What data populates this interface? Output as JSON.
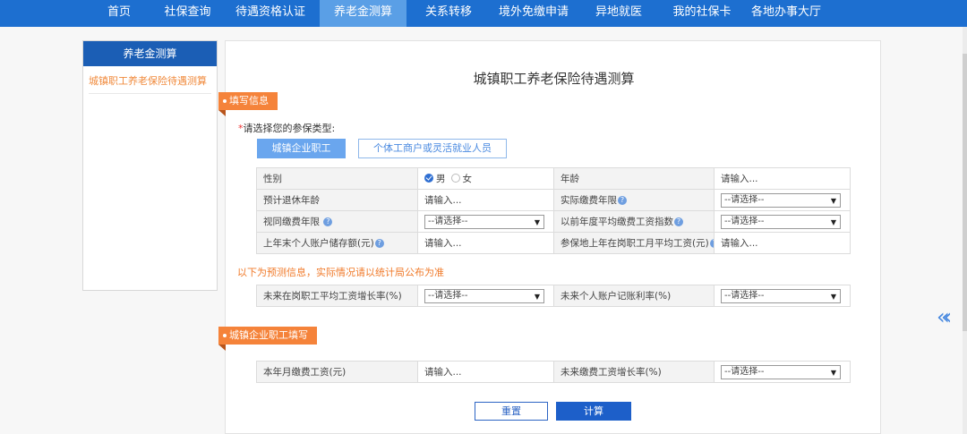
{
  "nav": {
    "items": [
      {
        "label": "首页",
        "active": false
      },
      {
        "label": "社保查询",
        "active": false
      },
      {
        "label": "待遇资格认证",
        "active": false
      },
      {
        "label": "养老金测算",
        "active": true
      },
      {
        "label": "关系转移",
        "active": false
      },
      {
        "label": "境外免缴申请",
        "active": false
      },
      {
        "label": "异地就医",
        "active": false
      },
      {
        "label": "我的社保卡",
        "active": false
      },
      {
        "label": "各地办事大厅",
        "active": false
      }
    ]
  },
  "sidebar": {
    "title": "养老金测算",
    "items": [
      {
        "label": "城镇职工养老保险待遇测算",
        "active": true
      }
    ]
  },
  "main": {
    "title": "城镇职工养老保险待遇测算",
    "section1": "填写信息",
    "type_required_mark": "*",
    "type_label": "请选择您的参保类型:",
    "type_options": [
      "城镇企业职工",
      "个体工商户或灵活就业人员"
    ],
    "form": {
      "gender_label": "性别",
      "gender_options": [
        "男",
        "女"
      ],
      "gender_selected": "男",
      "age_label": "年龄",
      "age_placeholder": "请输入...",
      "retire_age_label": "预计退休年龄",
      "retire_age_placeholder": "请输入...",
      "paid_years_label": "实际缴费年限",
      "paid_years_value": "--请选择--",
      "deemed_years_label": "视同缴费年限",
      "deemed_years_value": "--请选择--",
      "avg_index_label": "以前年度平均缴费工资指数",
      "avg_index_value": "--请选择--",
      "account_label": "上年末个人账户储存额(元)",
      "account_placeholder": "请输入...",
      "local_wage_label": "参保地上年在岗职工月平均工资(元)",
      "local_wage_placeholder": "请输入..."
    },
    "note": "以下为预测信息，实际情况请以统计局公布为准",
    "forecast": {
      "wage_growth_label": "未来在岗职工平均工资增长率(%)",
      "wage_growth_value": "--请选择--",
      "account_rate_label": "未来个人账户记账利率(%)",
      "account_rate_value": "--请选择--"
    },
    "section2": "城镇企业职工填写",
    "employee": {
      "monthly_wage_label": "本年月缴费工资(元)",
      "monthly_wage_placeholder": "请输入...",
      "wage_growth_label": "未来缴费工资增长率(%)",
      "wage_growth_value": "--请选择--"
    },
    "buttons": {
      "reset": "重置",
      "calc": "计算"
    }
  },
  "icons": {
    "help": "help-icon",
    "collapse": "double-chevron-left-icon",
    "caret": "caret-down-icon"
  },
  "colors": {
    "nav_bg": "#1d6fd0",
    "nav_active": "#5a9fe6",
    "accent_orange": "#f5833a",
    "primary_button": "#1d5fc9"
  }
}
